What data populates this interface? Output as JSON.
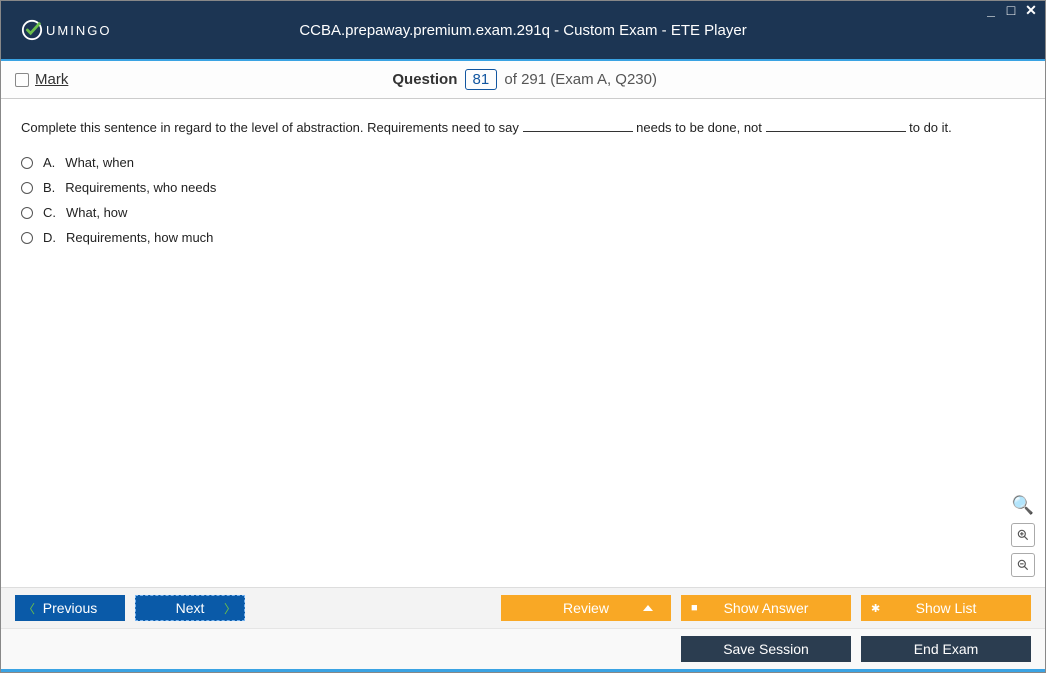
{
  "window": {
    "title": "CCBA.prepaway.premium.exam.291q - Custom Exam - ETE Player",
    "logo_text": "UMINGO"
  },
  "mark": {
    "label": "Mark"
  },
  "question_header": {
    "prefix": "Question",
    "number": "81",
    "suffix": "of 291 (Exam A, Q230)"
  },
  "question": {
    "text_before": "Complete this sentence in regard to the level of abstraction. Requirements need to say ",
    "text_mid": " needs to be done, not ",
    "text_after": " to do it.",
    "options": [
      {
        "letter": "A.",
        "text": "What, when"
      },
      {
        "letter": "B.",
        "text": "Requirements, who needs"
      },
      {
        "letter": "C.",
        "text": "What, how"
      },
      {
        "letter": "D.",
        "text": "Requirements, how much"
      }
    ]
  },
  "buttons": {
    "previous": "Previous",
    "next": "Next",
    "review": "Review",
    "show_answer": "Show Answer",
    "show_list": "Show List",
    "save_session": "Save Session",
    "end_exam": "End Exam"
  }
}
